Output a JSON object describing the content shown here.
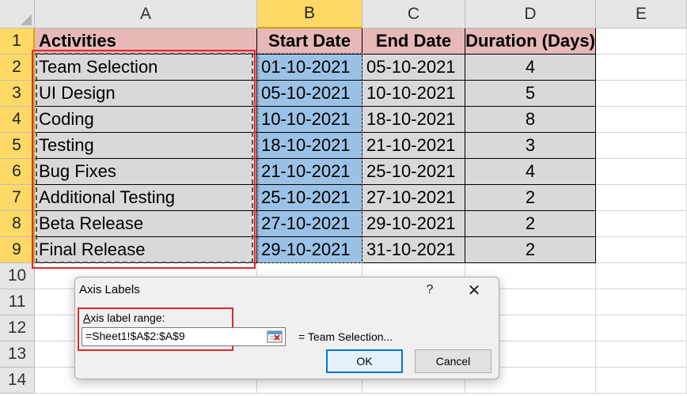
{
  "columns": [
    "A",
    "B",
    "C",
    "D",
    "E"
  ],
  "rows": [
    "1",
    "2",
    "3",
    "4",
    "5",
    "6",
    "7",
    "8",
    "9",
    "10",
    "11",
    "12",
    "13",
    "14"
  ],
  "table": {
    "headers": [
      "Activities",
      "Start Date",
      "End Date",
      "Duration (Days)"
    ],
    "data": [
      [
        "Team Selection",
        "01-10-2021",
        "05-10-2021",
        "4"
      ],
      [
        "UI Design",
        "05-10-2021",
        "10-10-2021",
        "5"
      ],
      [
        "Coding",
        "10-10-2021",
        "18-10-2021",
        "8"
      ],
      [
        "Testing",
        "18-10-2021",
        "21-10-2021",
        "3"
      ],
      [
        "Bug Fixes",
        "21-10-2021",
        "25-10-2021",
        "4"
      ],
      [
        "Additional Testing",
        "25-10-2021",
        "27-10-2021",
        "2"
      ],
      [
        "Beta Release",
        "27-10-2021",
        "29-10-2021",
        "2"
      ],
      [
        "Final Release",
        "29-10-2021",
        "31-10-2021",
        "2"
      ]
    ]
  },
  "dialog": {
    "title": "Axis Labels",
    "help": "?",
    "close": "✕",
    "label_accel": "A",
    "label_rest": "xis label range:",
    "input_value": "=Sheet1!$A$2:$A$9",
    "preview": "= Team Selection...",
    "ok": "OK",
    "cancel": "Cancel"
  },
  "colors": {
    "header_fill": "#e6b8b7",
    "data_fill": "#d9d9d9",
    "selected_fill": "#9bc2e6",
    "highlight_red": "#e0272c"
  },
  "icons": [
    "collapse-dialog-icon",
    "select-all-icon"
  ]
}
